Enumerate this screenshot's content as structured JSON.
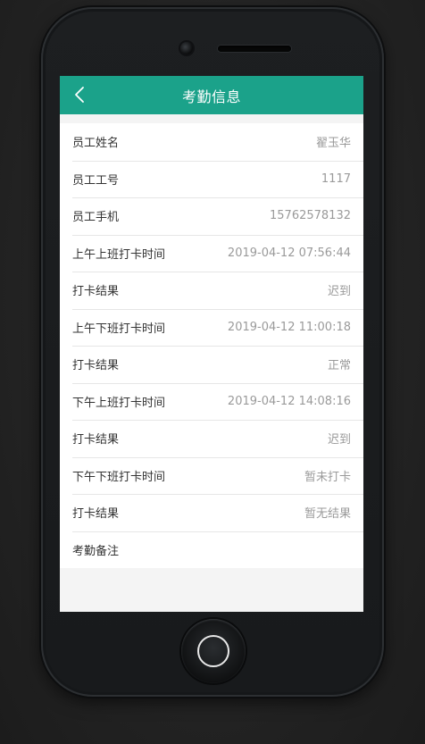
{
  "header": {
    "title": "考勤信息",
    "back_icon": "chevron-left-icon"
  },
  "rows": [
    {
      "label": "员工姓名",
      "value": "翟玉华"
    },
    {
      "label": "员工工号",
      "value": "1117"
    },
    {
      "label": "员工手机",
      "value": "15762578132"
    },
    {
      "label": "上午上班打卡时间",
      "value": "2019-04-12 07:56:44"
    },
    {
      "label": "打卡结果",
      "value": "迟到"
    },
    {
      "label": "上午下班打卡时间",
      "value": "2019-04-12 11:00:18"
    },
    {
      "label": "打卡结果",
      "value": "正常"
    },
    {
      "label": "下午上班打卡时间",
      "value": "2019-04-12 14:08:16"
    },
    {
      "label": "打卡结果",
      "value": "迟到"
    },
    {
      "label": "下午下班打卡时间",
      "value": "暂未打卡"
    },
    {
      "label": "打卡结果",
      "value": "暂无结果"
    },
    {
      "label": "考勤备注",
      "value": ""
    }
  ],
  "colors": {
    "header_bg": "#1ba28a",
    "label_text": "#333333",
    "value_text": "#9a9a9a"
  }
}
